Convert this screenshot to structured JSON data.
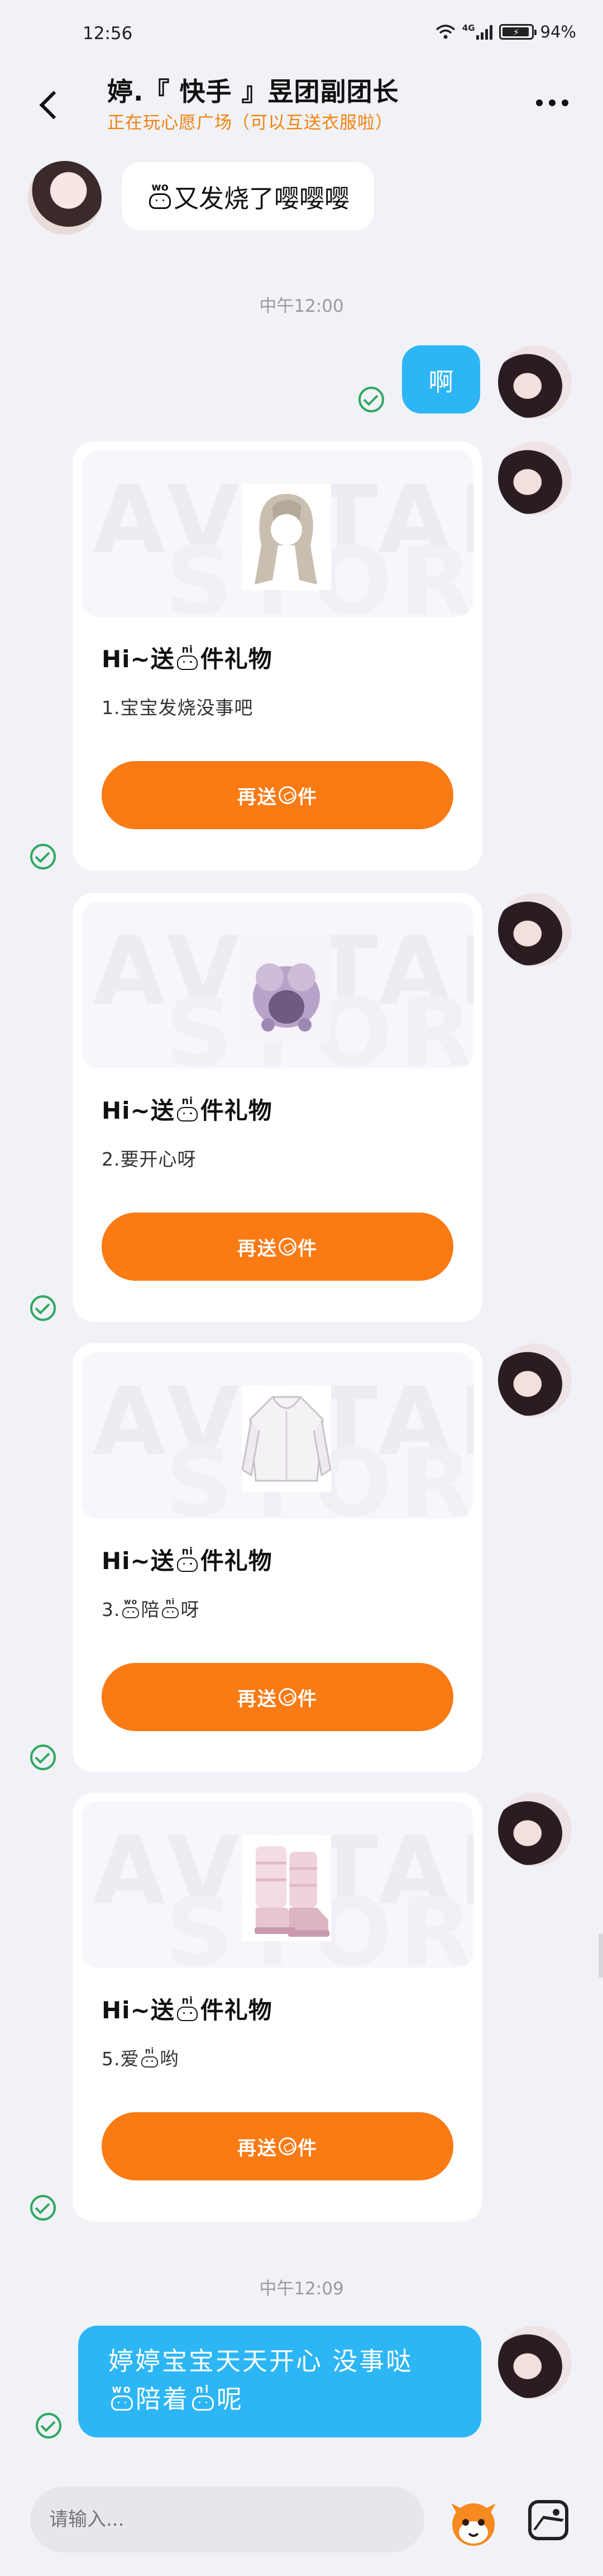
{
  "status_bar": {
    "time": "12:56",
    "network": "4G",
    "battery": "94%",
    "battery_level": 0.94
  },
  "header": {
    "title": "婷.『 快手 』昱团副团长",
    "subtitle": "正在玩心愿广场（可以互送衣服啦）"
  },
  "messages": {
    "m1": {
      "prefix_token": "wo",
      "text": "又发烧了嘤嘤嘤"
    },
    "ts1": "中午12:00",
    "m2": {
      "text": "啊"
    },
    "ts2": "中午12:09",
    "m3": {
      "line1": "婷婷宝宝天天开心   没事哒",
      "token1": "wo",
      "mid": "陪着",
      "token2": "ni",
      "end": "呢"
    }
  },
  "gift_cards": [
    {
      "watermark1": "AVATAR",
      "watermark2": "STORE",
      "title_pre": "Hi~送",
      "title_token": "ni",
      "title_post": "件礼物",
      "desc_pre": "1.宝宝发烧没事吧",
      "button_pre": "再送",
      "button_post": "件",
      "item": "wig"
    },
    {
      "watermark1": "AVATAR",
      "watermark2": "STORE",
      "title_pre": "Hi~送",
      "title_token": "ni",
      "title_post": "件礼物",
      "desc_pre": "2.要开心呀",
      "button_pre": "再送",
      "button_post": "件",
      "item": "hat"
    },
    {
      "watermark1": "AVATAR",
      "watermark2": "STORE",
      "title_pre": "Hi~送",
      "title_token": "ni",
      "title_post": "件礼物",
      "desc_pre": "3.",
      "desc_token1": "wo",
      "desc_mid": "陪",
      "desc_token2": "ni",
      "desc_post": "呀",
      "button_pre": "再送",
      "button_post": "件",
      "item": "coat"
    },
    {
      "watermark1": "AVATAR",
      "watermark2": "STORE",
      "title_pre": "Hi~送",
      "title_token": "ni",
      "title_post": "件礼物",
      "desc_pre": "5.爱",
      "desc_token1": "ni",
      "desc_post": "哟",
      "button_pre": "再送",
      "button_post": "件",
      "item": "boots"
    }
  ],
  "input": {
    "placeholder": "请输入..."
  },
  "colors": {
    "accent_orange": "#FA7A14",
    "bubble_blue": "#2DB6F5",
    "subtitle_orange": "#F0820F",
    "sent_check": "#2FA860"
  },
  "icons": {
    "back": "back-arrow-icon",
    "more": "more-dots-icon",
    "mascot": "kwai-mascot-icon",
    "image": "image-icon",
    "sent": "sent-check-icon"
  }
}
